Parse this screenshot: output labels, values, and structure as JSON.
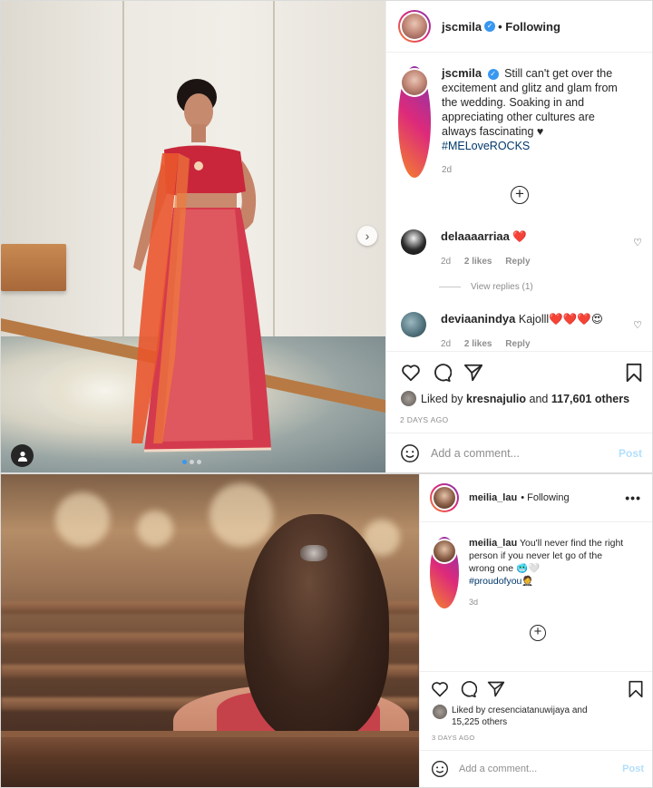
{
  "post1": {
    "username": "jscmila",
    "follow_status": "• Following",
    "caption_text": "Still can't get over the excitement and glitz and glam from the wedding. Soaking in and appreciating other cultures are always fascinating ♥",
    "hashtag": "#MELoveROCKS",
    "caption_time": "2d",
    "comments": [
      {
        "user": "delaaaarriaa",
        "text": "❤️",
        "time": "2d",
        "likes": "2 likes",
        "reply": "Reply"
      },
      {
        "user": "deviaanindya",
        "text": "Kajolll❤️❤️❤️😍",
        "time": "2d",
        "likes": "2 likes",
        "reply": "Reply"
      }
    ],
    "view_replies": "View replies (1)",
    "liked_by_prefix": "Liked by",
    "liked_by_user": "kresnajulio",
    "liked_by_and": "and",
    "liked_by_count": "117,601 others",
    "time_ago": "2 DAYS AGO",
    "add_comment_placeholder": "Add a comment...",
    "post_button": "Post",
    "carousel_total": 3,
    "carousel_active": 1
  },
  "post2": {
    "username": "meilia_lau",
    "follow_status": "• Following",
    "more": "•••",
    "caption_text": "You'll never find the right person if you never let go of the wrong one 🥶🤍",
    "hashtag": "#proudofyou🤵",
    "caption_time": "3d",
    "liked_by_prefix": "Liked by",
    "liked_by_user": "cresenciatanuwijaya",
    "liked_by_and": "and",
    "liked_by_count": "15,225 others",
    "time_ago": "3 DAYS AGO",
    "add_comment_placeholder": "Add a comment...",
    "post_button": "Post"
  },
  "icons": {
    "verified": "✓",
    "heart_filled": "❤️",
    "heart_small": "♡",
    "plus": "+",
    "chevron_right": "›"
  },
  "colors": {
    "link": "#00376b",
    "verified": "#3897f0",
    "post_button_disabled": "#b2dffc",
    "muted": "#8e8e8e",
    "text": "#262626"
  }
}
